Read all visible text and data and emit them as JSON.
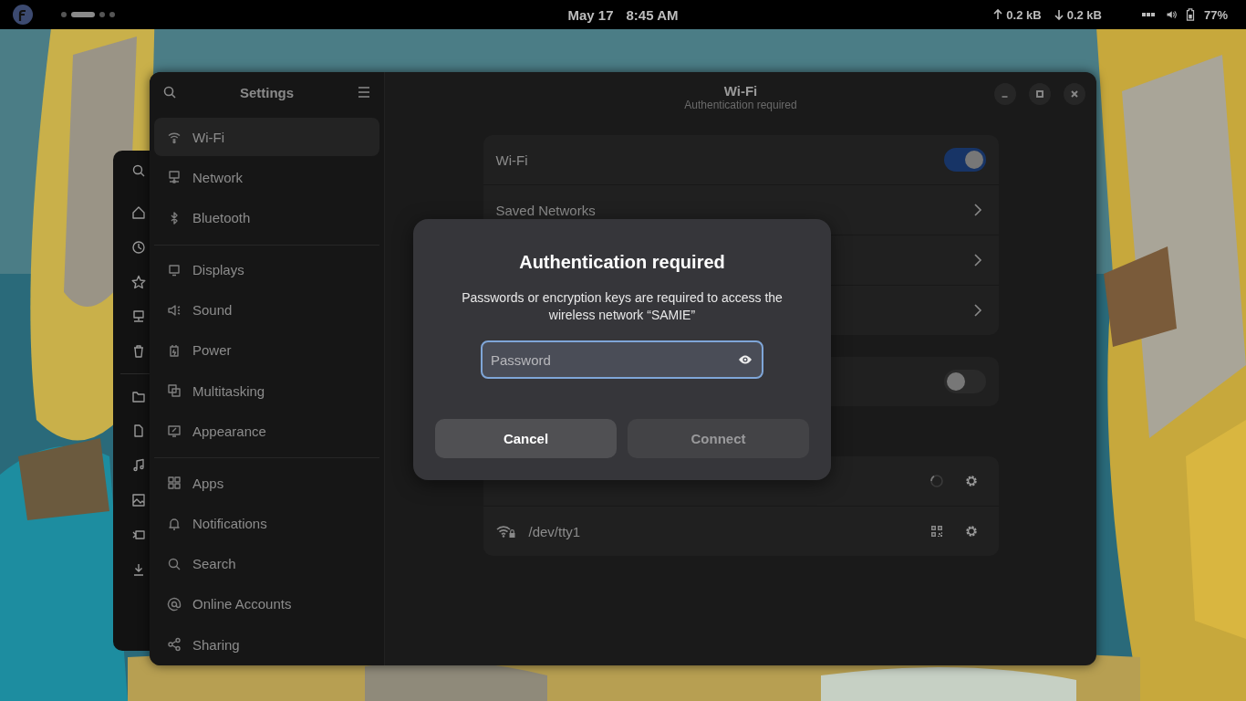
{
  "top_bar": {
    "workspaces": [
      {
        "selected": false
      },
      {
        "selected": true
      },
      {
        "selected": false
      },
      {
        "selected": false
      }
    ],
    "date": "May 17",
    "time": "8:45 AM",
    "upload": "0.2 kB",
    "download": "0.2 kB",
    "battery": "77%"
  },
  "settings": {
    "title": "Settings",
    "page_title": "Wi-Fi",
    "page_subtitle": "Authentication required",
    "sidebar": [
      {
        "items": [
          {
            "label": "Wi-Fi",
            "selected": true
          },
          {
            "label": "Network",
            "selected": false
          },
          {
            "label": "Bluetooth",
            "selected": false
          }
        ]
      },
      {
        "items": [
          {
            "label": "Displays",
            "selected": false
          },
          {
            "label": "Sound",
            "selected": false
          },
          {
            "label": "Power",
            "selected": false
          },
          {
            "label": "Multitasking",
            "selected": false
          },
          {
            "label": "Appearance",
            "selected": false
          }
        ]
      },
      {
        "items": [
          {
            "label": "Apps",
            "selected": false
          },
          {
            "label": "Notifications",
            "selected": false
          },
          {
            "label": "Search",
            "selected": false
          },
          {
            "label": "Online Accounts",
            "selected": false
          },
          {
            "label": "Sharing",
            "selected": false
          }
        ]
      }
    ],
    "groups": [
      {
        "rows": [
          {
            "kind": "switch",
            "label": "Wi-Fi",
            "on": true
          },
          {
            "kind": "link",
            "label": "Saved Networks"
          },
          {
            "kind": "link"
          },
          {
            "kind": "link"
          }
        ]
      },
      {
        "rows": [
          {
            "kind": "switch",
            "on": false
          }
        ]
      },
      {
        "rows": [
          {
            "kind": "connecting"
          },
          {
            "kind": "network",
            "label": "/dev/tty1"
          }
        ]
      }
    ]
  },
  "dialog": {
    "title": "Authentication required",
    "message": "Passwords or encryption keys are required to access the wireless network “SAMIE”",
    "password": {
      "placeholder": "Password"
    },
    "buttons": [
      {
        "label": "Cancel",
        "disabled": false
      },
      {
        "label": "Connect",
        "disabled": true
      }
    ]
  }
}
